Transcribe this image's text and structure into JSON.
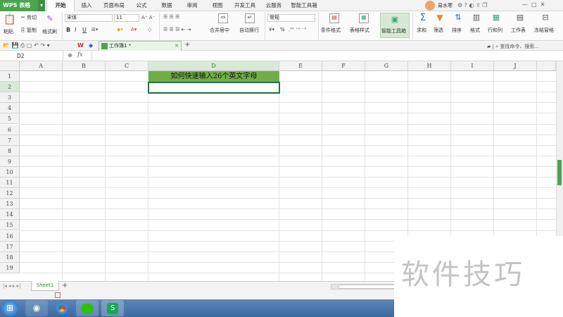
{
  "app": {
    "name": "WPS 表格",
    "menu_arrow": "▾"
  },
  "menus": [
    "开始",
    "插入",
    "页面布局",
    "公式",
    "数据",
    "审阅",
    "视图",
    "开发工具",
    "云服务",
    "智能工具箱"
  ],
  "user": {
    "name": "易水寒"
  },
  "ribbon": {
    "paste": "粘贴",
    "cut": "剪切",
    "copy": "复制",
    "format_painter": "格式刷",
    "font_name": "宋体",
    "font_size": "11",
    "merge_center": "合并居中",
    "wrap_text": "自动换行",
    "number_format": "常规",
    "conditional_format": "条件格式",
    "table_style": "表格样式",
    "smart_toolbox": "智能工具箱",
    "sum": "求和",
    "filter": "筛选",
    "sort": "排序",
    "format": "格式",
    "row_col": "行和列",
    "worksheet": "工作表",
    "freeze": "冻结窗格",
    "bold": "B",
    "italic": "I",
    "underline": "U",
    "percent": "%"
  },
  "doc_tab": {
    "title": "工作簿1 *",
    "add": "+"
  },
  "search": {
    "placeholder": "查找命令、搜索..."
  },
  "formula_bar": {
    "cell_ref": "D2",
    "fx": "fx"
  },
  "sheet": {
    "columns": [
      "A",
      "B",
      "C",
      "D",
      "E",
      "F",
      "G",
      "H",
      "I",
      "J"
    ],
    "rows": [
      "1",
      "2",
      "3",
      "4",
      "5",
      "6",
      "7",
      "8",
      "9",
      "10",
      "11",
      "12",
      "13",
      "14",
      "15",
      "16",
      "17",
      "18",
      "19"
    ],
    "selected_column": "D",
    "selected_row": "2",
    "d1_text": "如何快速输入26个英文字母",
    "d1_fill": "#70ad47"
  },
  "sheet_tabs": {
    "active": "Sheet1",
    "add": "+"
  },
  "taskbar": [
    "windows-start-icon",
    "chrome-icon",
    "wechat-icon",
    "wps-icon"
  ],
  "watermark": "软件技巧"
}
